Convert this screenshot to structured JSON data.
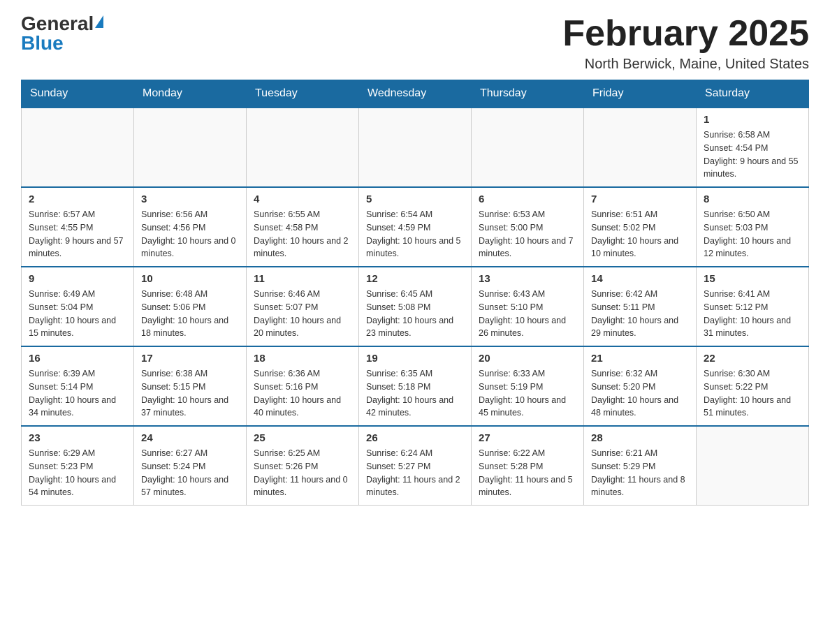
{
  "header": {
    "logo_general": "General",
    "logo_blue": "Blue",
    "month_title": "February 2025",
    "location": "North Berwick, Maine, United States"
  },
  "days_of_week": [
    "Sunday",
    "Monday",
    "Tuesday",
    "Wednesday",
    "Thursday",
    "Friday",
    "Saturday"
  ],
  "weeks": [
    [
      {
        "day": "",
        "info": ""
      },
      {
        "day": "",
        "info": ""
      },
      {
        "day": "",
        "info": ""
      },
      {
        "day": "",
        "info": ""
      },
      {
        "day": "",
        "info": ""
      },
      {
        "day": "",
        "info": ""
      },
      {
        "day": "1",
        "info": "Sunrise: 6:58 AM\nSunset: 4:54 PM\nDaylight: 9 hours and 55 minutes."
      }
    ],
    [
      {
        "day": "2",
        "info": "Sunrise: 6:57 AM\nSunset: 4:55 PM\nDaylight: 9 hours and 57 minutes."
      },
      {
        "day": "3",
        "info": "Sunrise: 6:56 AM\nSunset: 4:56 PM\nDaylight: 10 hours and 0 minutes."
      },
      {
        "day": "4",
        "info": "Sunrise: 6:55 AM\nSunset: 4:58 PM\nDaylight: 10 hours and 2 minutes."
      },
      {
        "day": "5",
        "info": "Sunrise: 6:54 AM\nSunset: 4:59 PM\nDaylight: 10 hours and 5 minutes."
      },
      {
        "day": "6",
        "info": "Sunrise: 6:53 AM\nSunset: 5:00 PM\nDaylight: 10 hours and 7 minutes."
      },
      {
        "day": "7",
        "info": "Sunrise: 6:51 AM\nSunset: 5:02 PM\nDaylight: 10 hours and 10 minutes."
      },
      {
        "day": "8",
        "info": "Sunrise: 6:50 AM\nSunset: 5:03 PM\nDaylight: 10 hours and 12 minutes."
      }
    ],
    [
      {
        "day": "9",
        "info": "Sunrise: 6:49 AM\nSunset: 5:04 PM\nDaylight: 10 hours and 15 minutes."
      },
      {
        "day": "10",
        "info": "Sunrise: 6:48 AM\nSunset: 5:06 PM\nDaylight: 10 hours and 18 minutes."
      },
      {
        "day": "11",
        "info": "Sunrise: 6:46 AM\nSunset: 5:07 PM\nDaylight: 10 hours and 20 minutes."
      },
      {
        "day": "12",
        "info": "Sunrise: 6:45 AM\nSunset: 5:08 PM\nDaylight: 10 hours and 23 minutes."
      },
      {
        "day": "13",
        "info": "Sunrise: 6:43 AM\nSunset: 5:10 PM\nDaylight: 10 hours and 26 minutes."
      },
      {
        "day": "14",
        "info": "Sunrise: 6:42 AM\nSunset: 5:11 PM\nDaylight: 10 hours and 29 minutes."
      },
      {
        "day": "15",
        "info": "Sunrise: 6:41 AM\nSunset: 5:12 PM\nDaylight: 10 hours and 31 minutes."
      }
    ],
    [
      {
        "day": "16",
        "info": "Sunrise: 6:39 AM\nSunset: 5:14 PM\nDaylight: 10 hours and 34 minutes."
      },
      {
        "day": "17",
        "info": "Sunrise: 6:38 AM\nSunset: 5:15 PM\nDaylight: 10 hours and 37 minutes."
      },
      {
        "day": "18",
        "info": "Sunrise: 6:36 AM\nSunset: 5:16 PM\nDaylight: 10 hours and 40 minutes."
      },
      {
        "day": "19",
        "info": "Sunrise: 6:35 AM\nSunset: 5:18 PM\nDaylight: 10 hours and 42 minutes."
      },
      {
        "day": "20",
        "info": "Sunrise: 6:33 AM\nSunset: 5:19 PM\nDaylight: 10 hours and 45 minutes."
      },
      {
        "day": "21",
        "info": "Sunrise: 6:32 AM\nSunset: 5:20 PM\nDaylight: 10 hours and 48 minutes."
      },
      {
        "day": "22",
        "info": "Sunrise: 6:30 AM\nSunset: 5:22 PM\nDaylight: 10 hours and 51 minutes."
      }
    ],
    [
      {
        "day": "23",
        "info": "Sunrise: 6:29 AM\nSunset: 5:23 PM\nDaylight: 10 hours and 54 minutes."
      },
      {
        "day": "24",
        "info": "Sunrise: 6:27 AM\nSunset: 5:24 PM\nDaylight: 10 hours and 57 minutes."
      },
      {
        "day": "25",
        "info": "Sunrise: 6:25 AM\nSunset: 5:26 PM\nDaylight: 11 hours and 0 minutes."
      },
      {
        "day": "26",
        "info": "Sunrise: 6:24 AM\nSunset: 5:27 PM\nDaylight: 11 hours and 2 minutes."
      },
      {
        "day": "27",
        "info": "Sunrise: 6:22 AM\nSunset: 5:28 PM\nDaylight: 11 hours and 5 minutes."
      },
      {
        "day": "28",
        "info": "Sunrise: 6:21 AM\nSunset: 5:29 PM\nDaylight: 11 hours and 8 minutes."
      },
      {
        "day": "",
        "info": ""
      }
    ]
  ]
}
